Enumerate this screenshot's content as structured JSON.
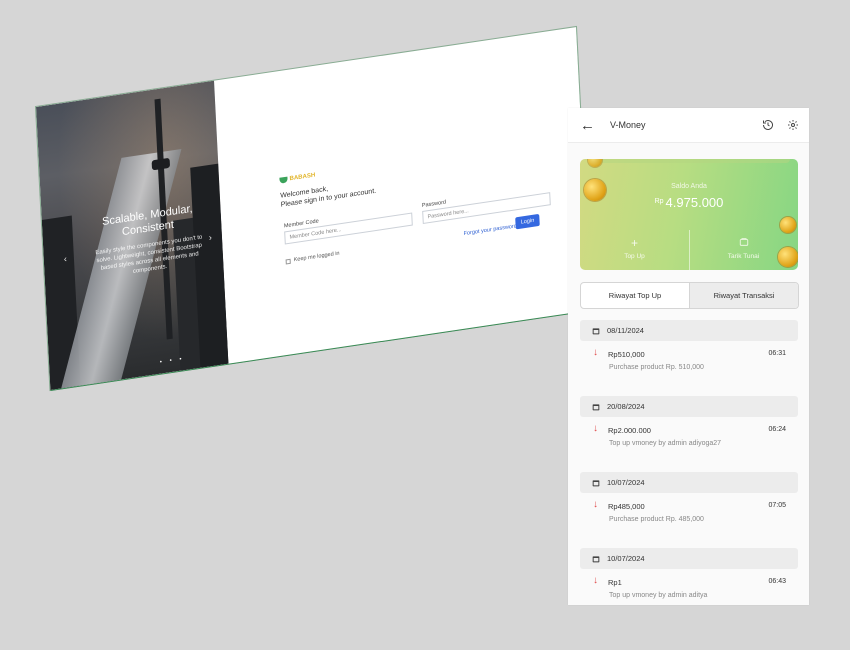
{
  "login_mockup": {
    "hero_title": "Scalable, Modular, Consistent",
    "hero_subtitle": "Easily style the components you don't to solve. Lightweight, consistent Bootstrap based styles across all elements and components.",
    "prev_arrow": "‹",
    "next_arrow": "›",
    "dots": "• • •",
    "brand": "BABASH",
    "welcome_line1": "Welcome back,",
    "welcome_line2": "Please sign in to your account.",
    "member_code_label": "Member Code",
    "member_code_placeholder": "Member Code here...",
    "password_label": "Password",
    "password_placeholder": "Password here...",
    "keep_logged_in": "Keep me logged in",
    "forgot_password": "Forgot your password?",
    "login_button": "Login"
  },
  "app": {
    "header": {
      "back_icon": "arrow-left-icon",
      "title": "V-Money",
      "history_icon": "history-icon",
      "settings_icon": "gear-icon"
    },
    "balance_card": {
      "label": "Saldo Anda",
      "currency": "Rp",
      "amount": "4.975.000",
      "top_up_label": "Top Up",
      "withdraw_label": "Tarik Tunai"
    },
    "tabs": [
      {
        "label": "Riwayat Top Up",
        "active": false
      },
      {
        "label": "Riwayat Transaksi",
        "active": true
      }
    ],
    "history": [
      {
        "date": "08/11/2024",
        "amount": "Rp510,000",
        "time": "06:31",
        "description": "Purchase product Rp. 510,000"
      },
      {
        "date": "20/08/2024",
        "amount": "Rp2.000.000",
        "time": "06:24",
        "description": "Top up vmoney by admin adiyoga27"
      },
      {
        "date": "10/07/2024",
        "amount": "Rp485,000",
        "time": "07:05",
        "description": "Purchase product Rp. 485,000"
      },
      {
        "date": "10/07/2024",
        "amount": "Rp1",
        "time": "06:43",
        "description": "Top up vmoney by admin aditya"
      }
    ]
  }
}
